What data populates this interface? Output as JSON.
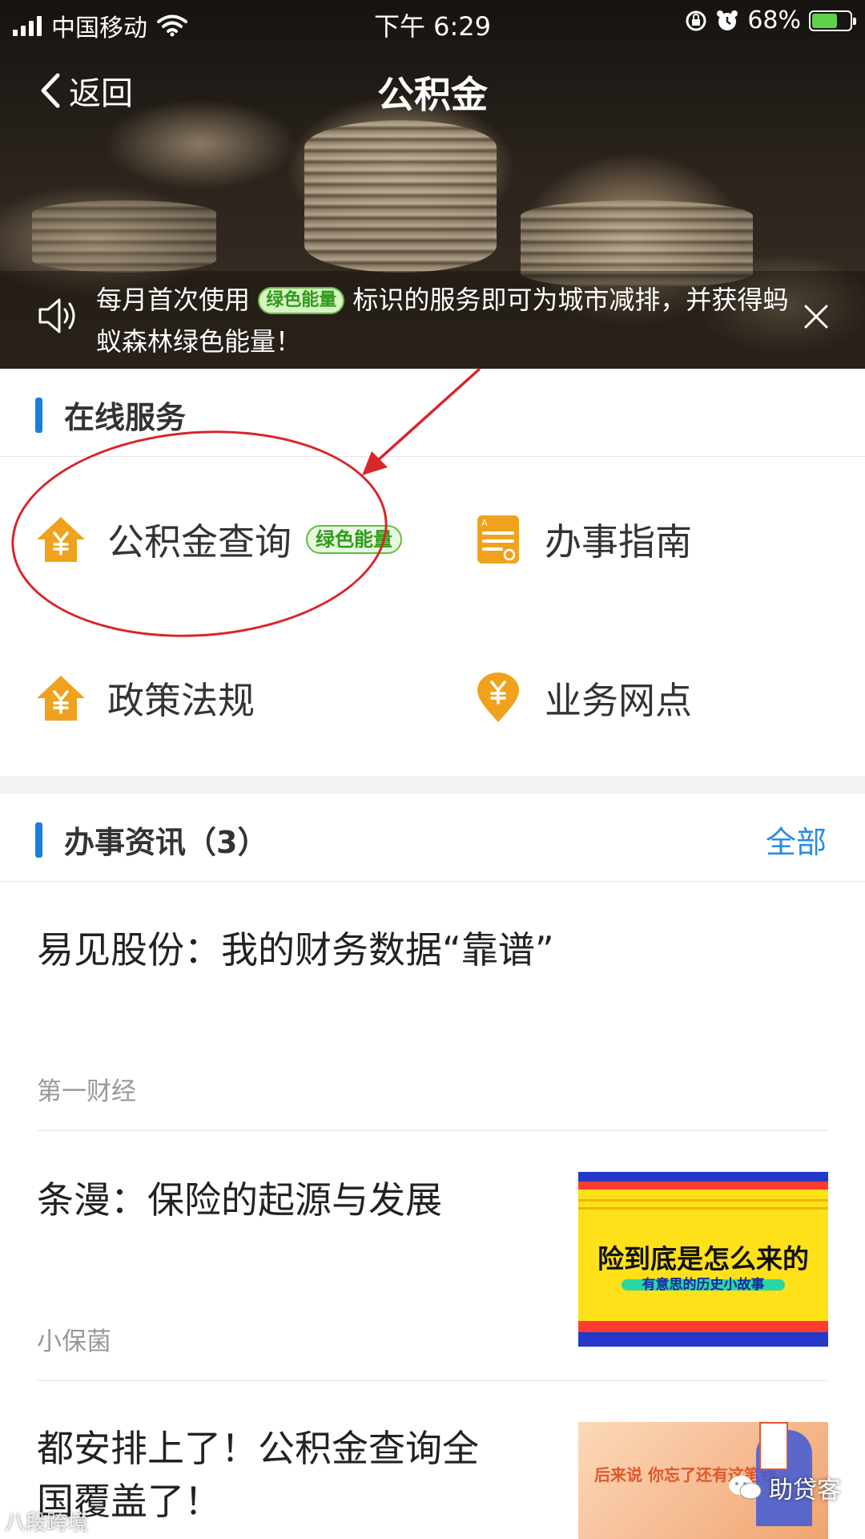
{
  "status_bar": {
    "carrier": "中国移动",
    "time": "下午 6:29",
    "battery_pct": "68%",
    "battery_level": 0.68
  },
  "nav": {
    "back_label": "返回",
    "title": "公积金"
  },
  "notice": {
    "text_before": "每月首次使用",
    "badge": "绿色能量",
    "text_after": "标识的服务即可为城市减排，并获得蚂蚁森林绿色能量！"
  },
  "online_services": {
    "title": "在线服务",
    "items": [
      {
        "label": "公积金查询",
        "icon": "house-yen-icon",
        "badge": "绿色能量"
      },
      {
        "label": "办事指南",
        "icon": "document-guide-icon"
      },
      {
        "label": "政策法规",
        "icon": "house-yen-icon"
      },
      {
        "label": "业务网点",
        "icon": "location-yen-icon"
      }
    ]
  },
  "news": {
    "title": "办事资讯（3）",
    "more": "全部",
    "items": [
      {
        "title": "易见股份：我的财务数据“靠谱”",
        "source": "第一财经"
      },
      {
        "title": "条漫：保险的起源与发展",
        "source": "小保菌",
        "thumb_title": "险到底是怎么来的",
        "thumb_subtitle": "有意思的历史小故事"
      },
      {
        "title_line1": "都安排上了！公积金查询全",
        "title_line2": "国覆盖了！",
        "thumb_text": "后来说 你忘了还有这笔钱"
      }
    ]
  },
  "watermarks": {
    "bottom_right": "助贷客",
    "bottom_left": "八段跨境"
  },
  "colors": {
    "accent_blue": "#1a7de0",
    "link_blue": "#2a8be6",
    "icon_orange": "#f0a21e",
    "badge_green": "#5fbf3e",
    "annotation_red": "#d8262b"
  }
}
